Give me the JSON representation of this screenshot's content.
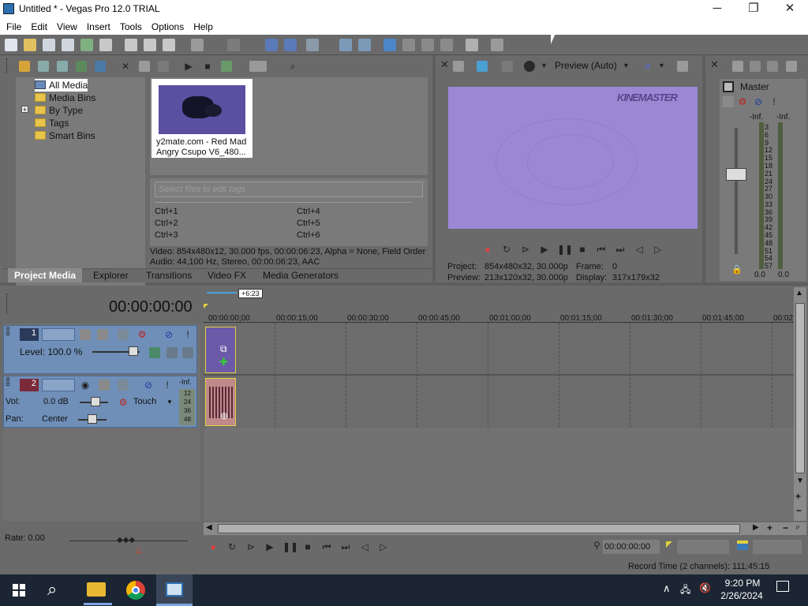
{
  "window": {
    "title": "Untitled * - Vegas Pro 12.0 TRIAL",
    "minimize": "─",
    "maximize": "❐",
    "close": "✕"
  },
  "menu": [
    "File",
    "Edit",
    "View",
    "Insert",
    "Tools",
    "Options",
    "Help"
  ],
  "explorer": {
    "items": [
      "All Media",
      "Media Bins",
      "By Type",
      "Tags",
      "Smart Bins"
    ],
    "expander": "+"
  },
  "media": {
    "thumb_caption": "y2mate.com - Red Mad Angry Csupo V6_480...",
    "tags_placeholder": "Select files to edit tags",
    "shortcuts": [
      "Ctrl+1",
      "Ctrl+2",
      "Ctrl+3",
      "Ctrl+4",
      "Ctrl+5",
      "Ctrl+6"
    ],
    "info_line1": "Video: 854x480x12, 30.000 fps, 00:00:06:23, Alpha = None, Field Order",
    "info_line2": "Audio: 44,100 Hz, Stereo, 00:00:06:23, AAC"
  },
  "tabs": [
    "Project Media",
    "Explorer",
    "Transitions",
    "Video FX",
    "Media Generators"
  ],
  "preview": {
    "mode": "Preview (Auto)",
    "watermark": "KINEMASTER",
    "project_label": "Project:",
    "project_value": "854x480x32, 30.000p",
    "preview_label": "Preview:",
    "preview_value": "213x120x32, 30.000p",
    "frame_label": "Frame:",
    "frame_value": "0",
    "display_label": "Display:",
    "display_value": "317x179x32"
  },
  "master": {
    "label": "Master",
    "inf_left": "-Inf.",
    "inf_right": "-Inf.",
    "scale": [
      "3",
      "6",
      "9",
      "12",
      "15",
      "18",
      "21",
      "24",
      "27",
      "30",
      "33",
      "36",
      "39",
      "42",
      "45",
      "48",
      "51",
      "54",
      "57"
    ],
    "val_left": "0.0",
    "val_right": "0.0"
  },
  "timeline": {
    "timecode": "00:00:00:00",
    "region_len": "+6:23",
    "ruler": [
      "00:00:00;00",
      "00:00:15;00",
      "00:00:30;00",
      "00:00:45;00",
      "00:01:00;00",
      "00:01:15;00",
      "00:01:30;00",
      "00:01:45;00",
      "00:02"
    ]
  },
  "track1": {
    "num": "1",
    "level_label": "Level: 100.0 %"
  },
  "track2": {
    "num": "2",
    "vol_label": "Vol:",
    "vol_value": "0.0 dB",
    "pan_label": "Pan:",
    "pan_value": "Center",
    "automation": "Touch",
    "meter_top": "-Inf.",
    "meter_scale": [
      "12",
      "24",
      "36",
      "48"
    ]
  },
  "transport": {
    "rate": "Rate: 0.00",
    "time": "00:00:00:00",
    "record_time": "Record Time (2 channels): 111:45:15"
  },
  "taskbar": {
    "time": "9:20 PM",
    "date": "2/26/2024"
  },
  "colors": {
    "accent": "#2f6fb0",
    "track_header": "#6f8fb8",
    "preview_purple": "#9a88d4",
    "clip_video": "#6b5aa8",
    "clip_audio": "#c08a8a"
  }
}
